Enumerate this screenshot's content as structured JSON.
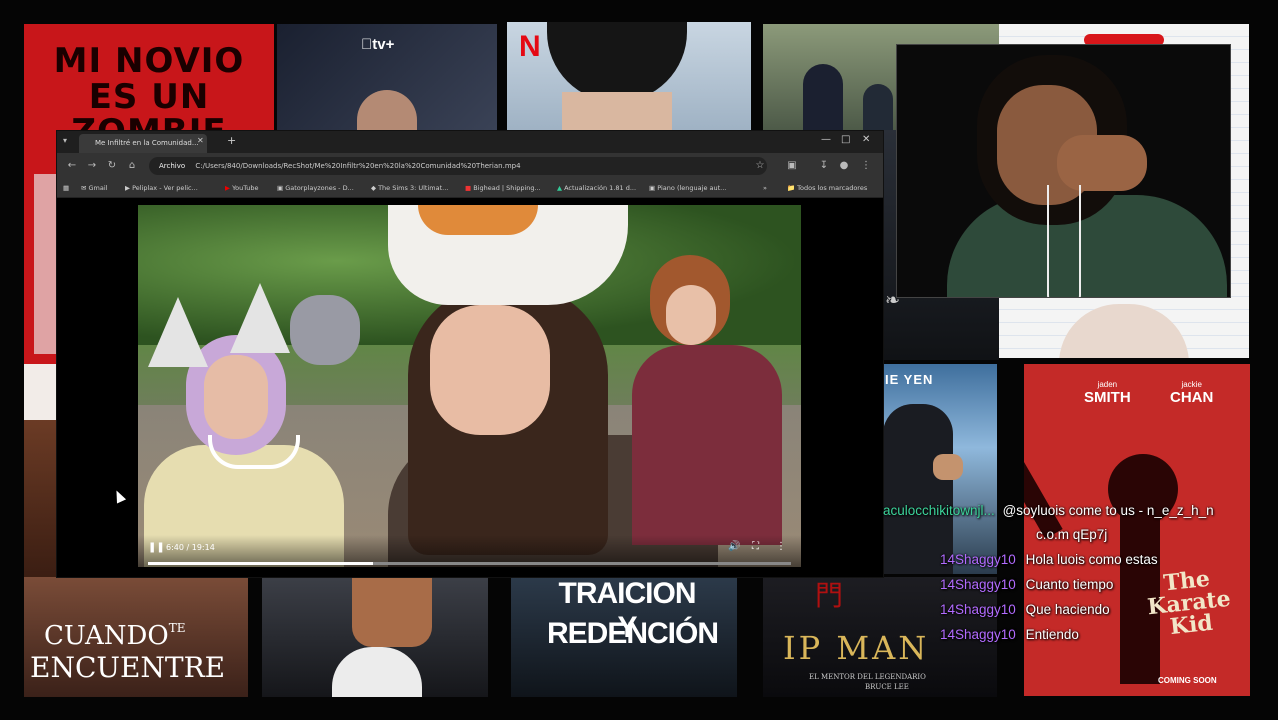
{
  "posters": {
    "zombie_title": "MI NOVIO ES UN ZOMBIE",
    "appletv_label": "tv+",
    "netflix_logo": "N",
    "karate_actor_1": "SMITH",
    "karate_actor_1_first": "jaden",
    "karate_actor_2": "CHAN",
    "karate_actor_2_first": "jackie",
    "karate_title": "The Karate Kid",
    "karate_footer": "COMING SOON",
    "ipman_top": "IE YEN",
    "ipman_title": "IP MAN",
    "ipman_subtitle": "EL MENTOR DEL LEGENDARIO",
    "ipman_subtitle2": "BRUCE LEE",
    "cuando_title": "CUANDO",
    "cuando_te": "TE",
    "cuando_title2": "ENCUENTRE",
    "traicion_title": "TRAICION Y",
    "traicion_title2": "REDENCIÓN"
  },
  "browser": {
    "tab_title": "Me Infiltré en la Comunidad...",
    "address_prefix": "Archivo",
    "address": "C:/Users/840/Downloads/RecShot/Me%20Infiltr%20en%20la%20Comunidad%20Therian.mp4",
    "bookmarks": [
      "Gmail",
      "Peliplax - Ver pelic...",
      "YouTube",
      "Gatorplayzones - D...",
      "The Sims 3: Ultimat...",
      "Bighead | Shipping...",
      "Actualización 1.81 d...",
      "Piano (lenguaje aut...",
      "Todos los marcadores"
    ],
    "video_time": "6:40 / 19:14",
    "video_progress": 0.35
  },
  "chat": {
    "messages": [
      {
        "user": "aculocchikitownjl...",
        "text": "@soyluois come to us - n_e_z_h_n",
        "color": "green"
      },
      {
        "user": "",
        "text": "c.o.m qEp7j",
        "color": "none"
      },
      {
        "user": "14Shaggy10",
        "text": "Hola luois como estas",
        "color": "purple"
      },
      {
        "user": "14Shaggy10",
        "text": "Cuanto tiempo",
        "color": "purple"
      },
      {
        "user": "14Shaggy10",
        "text": "Que haciendo",
        "color": "purple"
      },
      {
        "user": "14Shaggy10",
        "text": "Entiendo",
        "color": "purple"
      }
    ]
  },
  "colors": {
    "zombie_bg": "#c8161a",
    "karate_bg": "#c42a28",
    "chat_user": "#b26bff",
    "chat_user_alt": "#3cd39a"
  }
}
